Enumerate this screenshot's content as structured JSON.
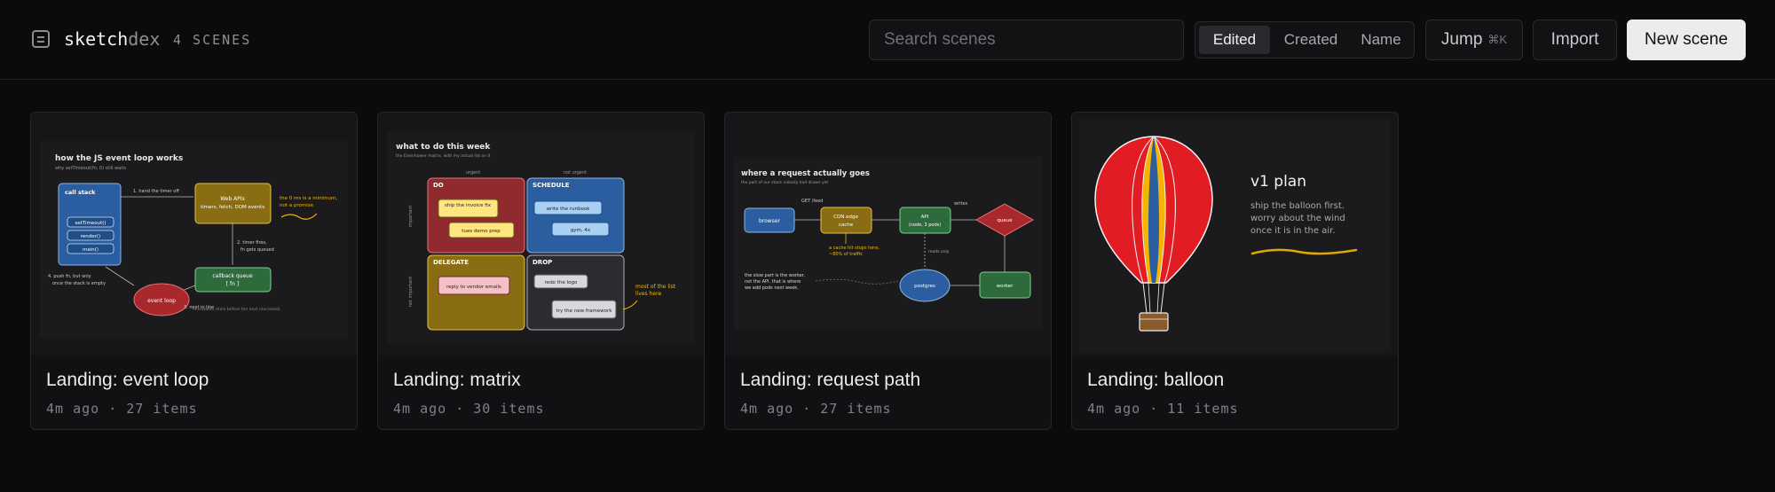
{
  "app": {
    "brand_main": "sketch",
    "brand_sub": "dex",
    "scene_count": "4 SCENES"
  },
  "toolbar": {
    "search_placeholder": "Search scenes",
    "sort_options": [
      "Edited",
      "Created",
      "Name"
    ],
    "sort_active": "Edited",
    "jump_label": "Jump",
    "jump_shortcut": "⌘K",
    "import_label": "Import",
    "new_scene_label": "New scene"
  },
  "scenes": [
    {
      "title": "Landing: event loop",
      "meta": "4m ago · 27 items",
      "sketch": {
        "heading": "how the JS event loop works",
        "subheading": "why setTimeout(fn, 0) still waits",
        "call_stack": "call stack",
        "stack_items": [
          "setTimeout()",
          "render()",
          "main()"
        ],
        "web_apis": "Web APIs",
        "web_apis_sub": "timers, fetch, DOM events",
        "callback_queue": "callback queue",
        "callback_sub": "[ fn ]",
        "event_loop": "event loop",
        "step1": "1. hand the timer off",
        "step2a": "2. timer fires,",
        "step2b": "fn gets queued",
        "step3": "3. next in line",
        "step4a": "4. push fn, but only",
        "step4b": "once the stack is empty",
        "note1": "the 0 ms is a minimum,",
        "note2": "not a promise",
        "footer": "microtasks drain before the next macrotask"
      }
    },
    {
      "title": "Landing: matrix",
      "meta": "4m ago · 30 items",
      "sketch": {
        "heading": "what to do this week",
        "subheading": "the Eisenhower matrix, with my actual list on it",
        "col_urgent": "urgent",
        "col_not_urgent": "not urgent",
        "row_important": "important",
        "row_not_important": "not important",
        "do": "DO",
        "schedule": "SCHEDULE",
        "delegate": "DELEGATE",
        "drop": "DROP",
        "do_items": [
          "ship the invoice fix",
          "tues demo prep"
        ],
        "schedule_items": [
          "write the runbook",
          "gym, 4x"
        ],
        "delegate_items": [
          "reply to vendor emails"
        ],
        "drop_items": [
          "redo the logo",
          "try the new framework"
        ],
        "note1": "most of the list",
        "note2": "lives here"
      }
    },
    {
      "title": "Landing: request path",
      "meta": "4m ago · 27 items",
      "sketch": {
        "heading": "where a request actually goes",
        "subheading": "the part of our stack nobody had drawn yet",
        "browser": "browser",
        "cdn1": "CDN edge",
        "cdn2": "cache",
        "api1": "API",
        "api2": "(node, 3 pods)",
        "queue": "queue",
        "worker": "worker",
        "postgres": "postgres",
        "get_feed": "GET /feed",
        "writes": "writes",
        "reads_only": "reads only",
        "cache_note1": "a cache hit stops here,",
        "cache_note2": "~80% of traffic",
        "slow1": "the slow part is the worker,",
        "slow2": "not the API. that is where",
        "slow3": "we add pods next week."
      }
    },
    {
      "title": "Landing: balloon",
      "meta": "4m ago · 11 items",
      "sketch": {
        "heading": "v1 plan",
        "line1": "ship the balloon first.",
        "line2": "worry about the wind",
        "line3": "once it is in the air."
      }
    }
  ]
}
